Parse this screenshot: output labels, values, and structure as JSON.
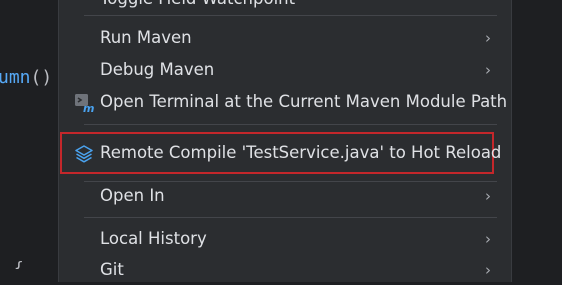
{
  "menu": {
    "items": [
      {
        "label": "Toggle Field Watchpoint",
        "submenu": false
      },
      {
        "label": "Run Maven",
        "submenu": true
      },
      {
        "label": "Debug Maven",
        "submenu": true
      },
      {
        "label": "Open Terminal at the Current Maven Module Path",
        "submenu": false,
        "icon": "terminal-maven-icon"
      },
      {
        "label": "Remote Compile 'TestService.java' to Hot Reload",
        "submenu": false,
        "icon": "layers-icon",
        "highlighted": true
      },
      {
        "label": "Open In",
        "submenu": true
      },
      {
        "label": "Local History",
        "submenu": true
      },
      {
        "label": "Git",
        "submenu": true
      }
    ],
    "chevron": "›"
  },
  "editor": {
    "fragment_name": "umn",
    "fragment_paren": "()",
    "bottom_glyph": "{"
  },
  "colors": {
    "highlight_border": "#c4272b",
    "menu_bg": "#2b2d30",
    "text": "#dfe1e5"
  }
}
